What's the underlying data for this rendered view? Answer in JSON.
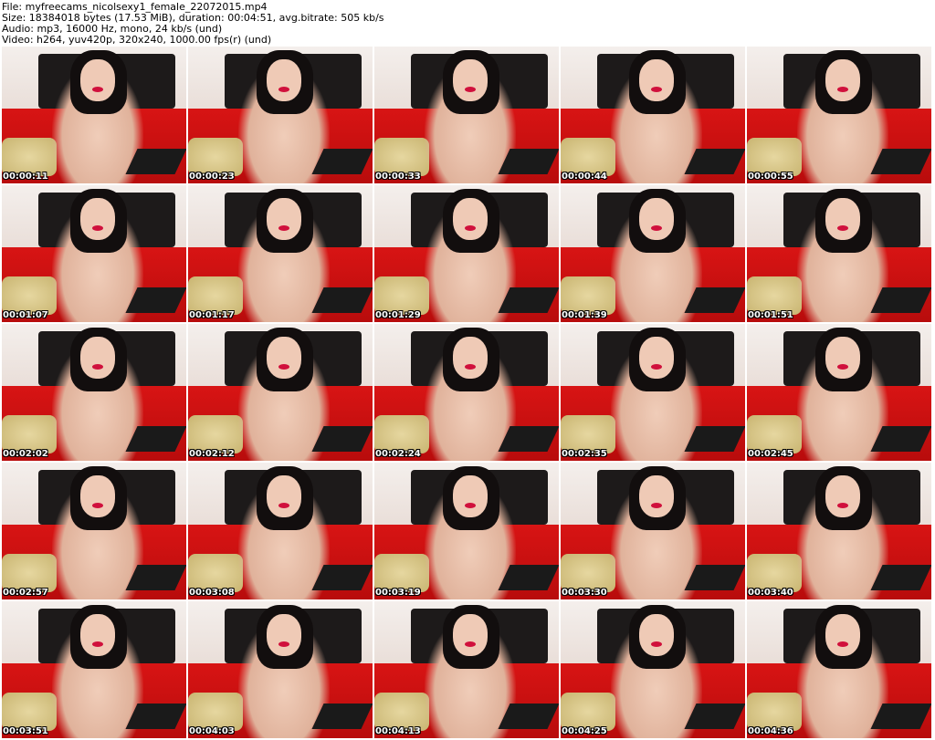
{
  "header": {
    "file_line": "File: myfreecams_nicolsexy1_female_22072015.mp4",
    "size_line": "Size: 18384018 bytes (17.53 MiB), duration: 00:04:51, avg.bitrate: 505 kb/s",
    "audio_line": "Audio: mp3, 16000 Hz, mono, 24 kb/s (und)",
    "video_line": "Video: h264, yuv420p, 320x240, 1000.00 fps(r) (und)"
  },
  "thumbnails": [
    {
      "timestamp": "00:00:11"
    },
    {
      "timestamp": "00:00:23"
    },
    {
      "timestamp": "00:00:33"
    },
    {
      "timestamp": "00:00:44"
    },
    {
      "timestamp": "00:00:55"
    },
    {
      "timestamp": "00:01:07"
    },
    {
      "timestamp": "00:01:17"
    },
    {
      "timestamp": "00:01:29"
    },
    {
      "timestamp": "00:01:39"
    },
    {
      "timestamp": "00:01:51"
    },
    {
      "timestamp": "00:02:02"
    },
    {
      "timestamp": "00:02:12"
    },
    {
      "timestamp": "00:02:24"
    },
    {
      "timestamp": "00:02:35"
    },
    {
      "timestamp": "00:02:45"
    },
    {
      "timestamp": "00:02:57"
    },
    {
      "timestamp": "00:03:08"
    },
    {
      "timestamp": "00:03:19"
    },
    {
      "timestamp": "00:03:30"
    },
    {
      "timestamp": "00:03:40"
    },
    {
      "timestamp": "00:03:51"
    },
    {
      "timestamp": "00:04:03"
    },
    {
      "timestamp": "00:04:13"
    },
    {
      "timestamp": "00:04:25"
    },
    {
      "timestamp": "00:04:36"
    }
  ]
}
